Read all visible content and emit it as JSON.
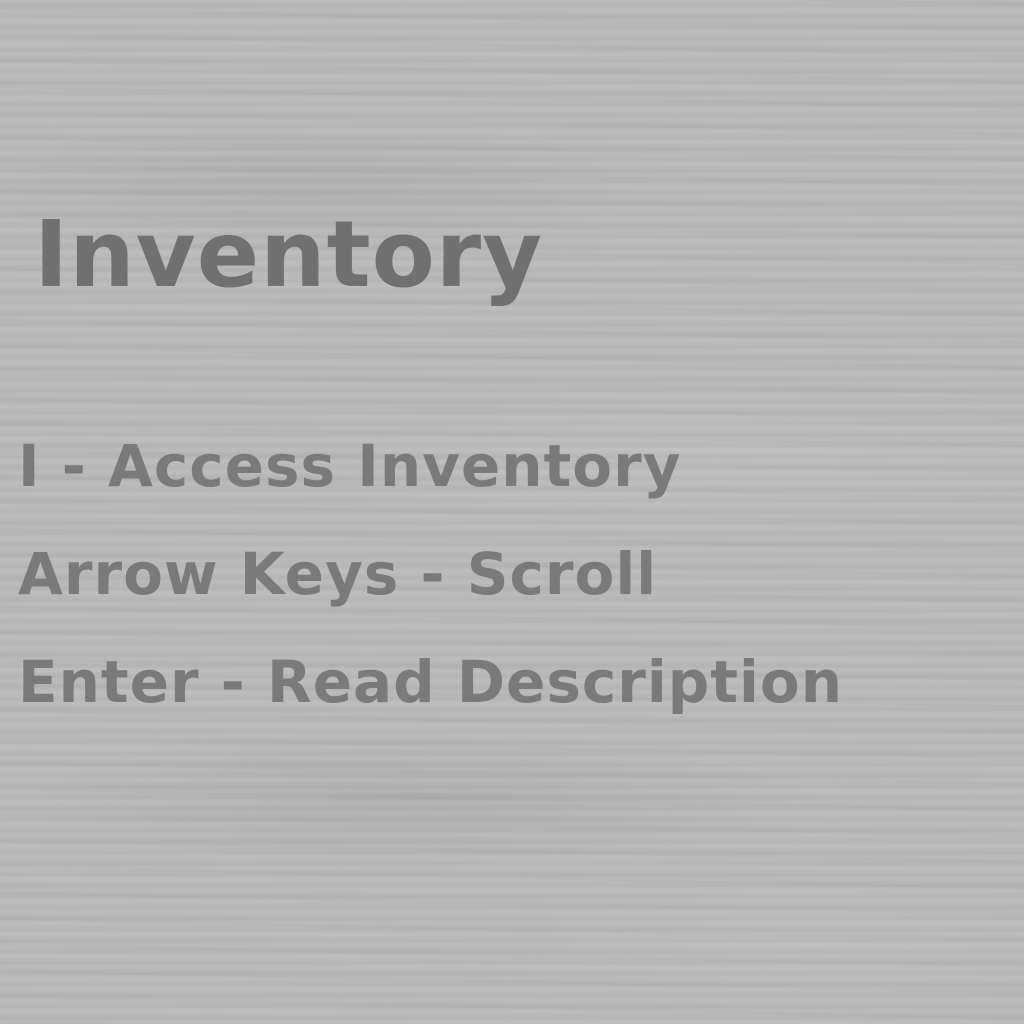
{
  "screen": {
    "title": "Inventory",
    "controls": [
      {
        "text": "I - Access Inventory"
      },
      {
        "text": "Arrow Keys - Scroll"
      },
      {
        "text": "Enter - Read Description"
      }
    ]
  },
  "colors": {
    "background": "#b9b9b9",
    "title_text": "#707070",
    "control_text": "#7a7a7a"
  }
}
